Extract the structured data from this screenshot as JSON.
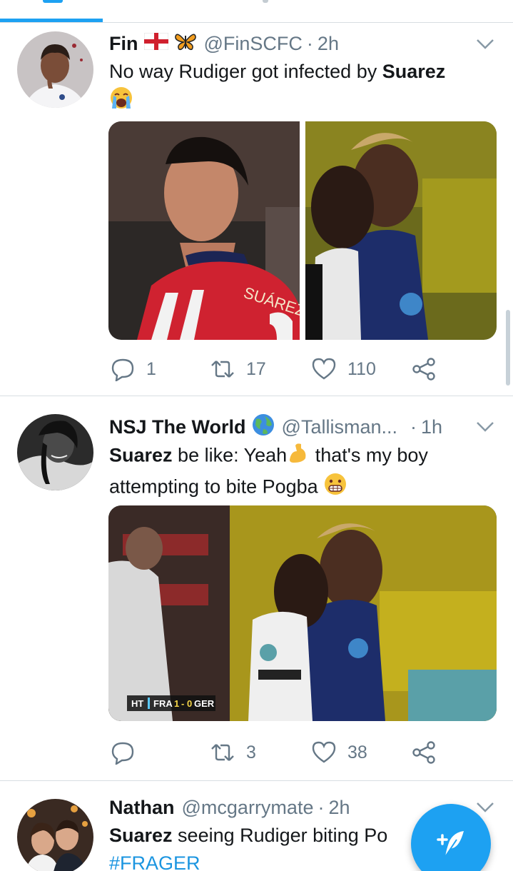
{
  "colors": {
    "accent": "#1da1f2",
    "text": "#14171a",
    "muted": "#657786",
    "divider": "#d8dee2"
  },
  "tweets": [
    {
      "name": "Fin",
      "handle": "@FinSCFC",
      "time": "2h",
      "badges": [
        "england-flag-icon",
        "butterfly-icon"
      ],
      "text_plain": "No way Rudiger got infected by ",
      "text_bold": "Suarez",
      "text_emoji": "loudly-crying-face-icon",
      "replies": "1",
      "retweets": "17",
      "likes": "110",
      "media": [
        "suarez-photo",
        "pogba-rudiger-photo"
      ],
      "jersey_text": "SUÁREZ"
    },
    {
      "name": "NSJ The World",
      "handle": "@Tallisman...",
      "time": "1h",
      "badges": [
        "globe-icon"
      ],
      "text_bold": "Suarez",
      "text_line1": " be like: Yeah",
      "text_line1b": " that's my boy",
      "text_line2": "attempting to bite Pogba ",
      "replies": "",
      "retweets": "3",
      "likes": "38",
      "media": [
        "rudiger-pogba-photo"
      ],
      "score": {
        "ht": "HT",
        "home": "FRA",
        "home_goals": "1",
        "sep": "-",
        "away_goals": "0",
        "away": "GER"
      }
    },
    {
      "name": "Nathan",
      "handle": "@mcgarrymate",
      "time": "2h",
      "text_bold": "Suarez",
      "text_line1": " seeing Rudiger biting Po",
      "hashtag": "#FRAGER"
    }
  ],
  "separator_dot": "·",
  "compose_button": "compose-tweet-icon"
}
